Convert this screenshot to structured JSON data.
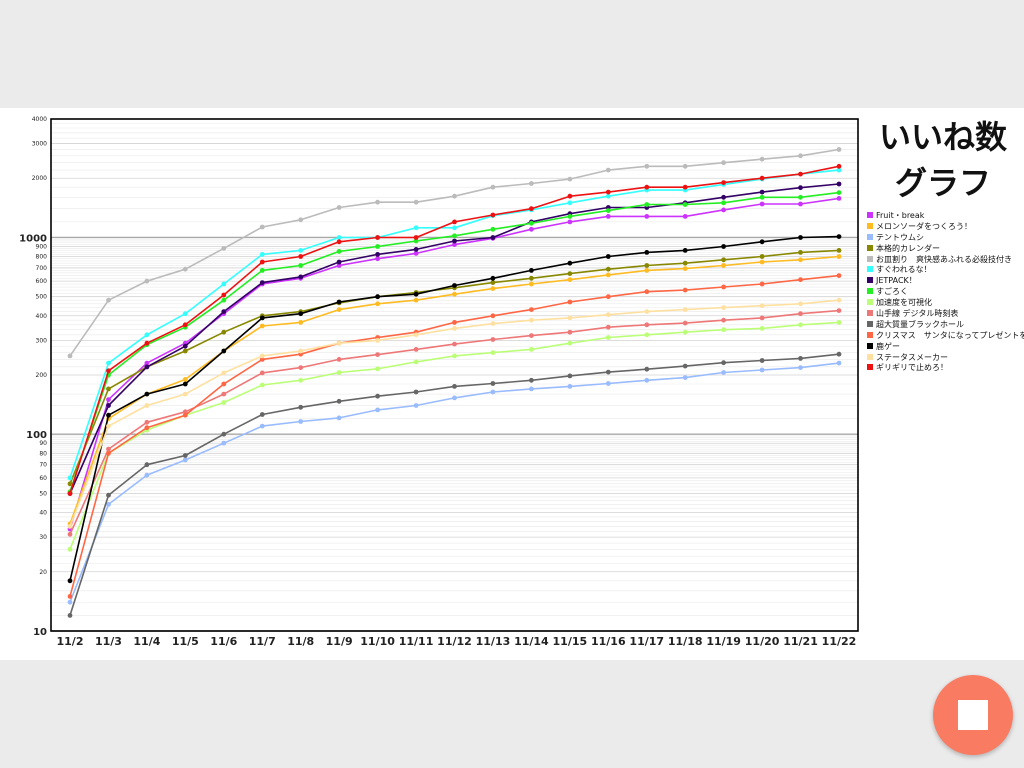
{
  "chart_data": {
    "type": "line",
    "title_lines": [
      "いいね数",
      "グラフ"
    ],
    "xlabel": "",
    "ylabel": "",
    "y_scale": "log",
    "ylim": [
      10,
      4000
    ],
    "grid": true,
    "legend_position": "right",
    "categories": [
      "11/2",
      "11/3",
      "11/4",
      "11/5",
      "11/6",
      "11/7",
      "11/8",
      "11/9",
      "11/10",
      "11/11",
      "11/12",
      "11/13",
      "11/14",
      "11/15",
      "11/16",
      "11/17",
      "11/18",
      "11/19",
      "11/20",
      "11/21",
      "11/22"
    ],
    "y_ticks": [
      {
        "value": 10,
        "label": "10",
        "major": true
      },
      {
        "value": 20,
        "label": "20"
      },
      {
        "value": 30,
        "label": "30"
      },
      {
        "value": 40,
        "label": "40"
      },
      {
        "value": 50,
        "label": "50"
      },
      {
        "value": 60,
        "label": "60"
      },
      {
        "value": 70,
        "label": "70"
      },
      {
        "value": 80,
        "label": "80"
      },
      {
        "value": 90,
        "label": "90"
      },
      {
        "value": 100,
        "label": "100",
        "major": true
      },
      {
        "value": 200,
        "label": "200"
      },
      {
        "value": 300,
        "label": "300"
      },
      {
        "value": 400,
        "label": "400"
      },
      {
        "value": 500,
        "label": "500"
      },
      {
        "value": 600,
        "label": "600"
      },
      {
        "value": 700,
        "label": "700"
      },
      {
        "value": 800,
        "label": "800"
      },
      {
        "value": 900,
        "label": "900"
      },
      {
        "value": 1000,
        "label": "1000",
        "major": true
      },
      {
        "value": 2000,
        "label": "2000"
      },
      {
        "value": 3000,
        "label": "3000"
      },
      {
        "value": 4000,
        "label": "4000"
      }
    ],
    "series": [
      {
        "name": "Fruit・break",
        "color": "#cc33ff",
        "values": [
          33,
          150,
          230,
          290,
          410,
          580,
          620,
          720,
          780,
          830,
          920,
          990,
          1100,
          1200,
          1280,
          1280,
          1280,
          1380,
          1480,
          1480,
          1580
        ]
      },
      {
        "name": "メロンソーダをつくろう！",
        "color": "#ffbb22",
        "values": [
          35,
          120,
          160,
          190,
          265,
          355,
          370,
          430,
          460,
          480,
          515,
          550,
          580,
          610,
          645,
          680,
          695,
          720,
          750,
          770,
          800
        ]
      },
      {
        "name": "テントウムシ",
        "color": "#99bbff",
        "values": [
          14,
          44,
          62,
          74,
          90,
          110,
          116,
          121,
          133,
          140,
          153,
          164,
          170,
          175,
          181,
          188,
          194,
          206,
          212,
          218,
          230
        ]
      },
      {
        "name": "本格的カレンダー",
        "color": "#888800",
        "values": [
          56,
          170,
          220,
          265,
          330,
          400,
          420,
          465,
          500,
          525,
          555,
          590,
          620,
          655,
          690,
          720,
          740,
          770,
          800,
          840,
          860
        ]
      },
      {
        "name": "お皿割り　爽快感あふれる必殺技付き",
        "color": "#bbbbbb",
        "values": [
          250,
          480,
          600,
          690,
          880,
          1130,
          1230,
          1420,
          1510,
          1510,
          1620,
          1800,
          1880,
          1980,
          2200,
          2300,
          2300,
          2400,
          2500,
          2600,
          2800
        ]
      },
      {
        "name": "すぐわれるな！",
        "color": "#33ffff",
        "values": [
          60,
          230,
          320,
          410,
          580,
          820,
          860,
          1000,
          1000,
          1120,
          1120,
          1290,
          1380,
          1500,
          1620,
          1740,
          1740,
          1860,
          1980,
          2100,
          2200
        ]
      },
      {
        "name": "JETPACK！",
        "color": "#330066",
        "values": [
          50,
          140,
          220,
          280,
          420,
          590,
          630,
          750,
          820,
          870,
          960,
          1000,
          1200,
          1320,
          1420,
          1420,
          1500,
          1600,
          1700,
          1790,
          1870
        ]
      },
      {
        "name": "すごろく",
        "color": "#22ee22",
        "values": [
          51,
          200,
          285,
          350,
          480,
          680,
          720,
          850,
          900,
          960,
          1020,
          1100,
          1180,
          1280,
          1370,
          1470,
          1470,
          1500,
          1600,
          1600,
          1690
        ]
      },
      {
        "name": "加速度を可視化",
        "color": "#bbff77",
        "values": [
          26,
          80,
          105,
          125,
          145,
          178,
          188,
          206,
          215,
          233,
          250,
          260,
          270,
          290,
          310,
          320,
          330,
          340,
          345,
          360,
          370
        ]
      },
      {
        "name": "山手線 デジタル時刻表",
        "color": "#ee7777",
        "values": [
          31,
          84,
          115,
          130,
          160,
          205,
          218,
          240,
          254,
          270,
          287,
          303,
          317,
          330,
          350,
          360,
          367,
          380,
          390,
          410,
          425
        ]
      },
      {
        "name": "超大質量ブラックホール",
        "color": "#666666",
        "values": [
          12,
          49,
          70,
          78,
          100,
          126,
          137,
          147,
          156,
          164,
          175,
          181,
          188,
          198,
          207,
          214,
          222,
          231,
          237,
          243,
          255
        ]
      },
      {
        "name": "クリスマス　サンタになってプレゼントをあ",
        "color": "#ff6644",
        "values": [
          15,
          80,
          108,
          125,
          180,
          240,
          255,
          290,
          310,
          330,
          370,
          400,
          430,
          470,
          500,
          530,
          540,
          560,
          580,
          610,
          640
        ]
      },
      {
        "name": "鹿ゲー",
        "color": "#000000",
        "values": [
          18,
          125,
          160,
          180,
          265,
          390,
          410,
          470,
          500,
          515,
          570,
          620,
          680,
          740,
          800,
          840,
          860,
          900,
          950,
          1000,
          1010
        ]
      },
      {
        "name": "ステータスメーカー",
        "color": "#ffe0a0",
        "values": [
          34,
          110,
          140,
          160,
          205,
          250,
          265,
          290,
          300,
          320,
          345,
          365,
          380,
          390,
          405,
          420,
          430,
          440,
          450,
          460,
          480
        ]
      },
      {
        "name": "ギリギリで止めろ！",
        "color": "#ee1111",
        "values": [
          50,
          210,
          290,
          360,
          510,
          750,
          800,
          950,
          1000,
          1000,
          1200,
          1300,
          1400,
          1620,
          1700,
          1800,
          1800,
          1900,
          2000,
          2100,
          2300
        ]
      }
    ]
  }
}
